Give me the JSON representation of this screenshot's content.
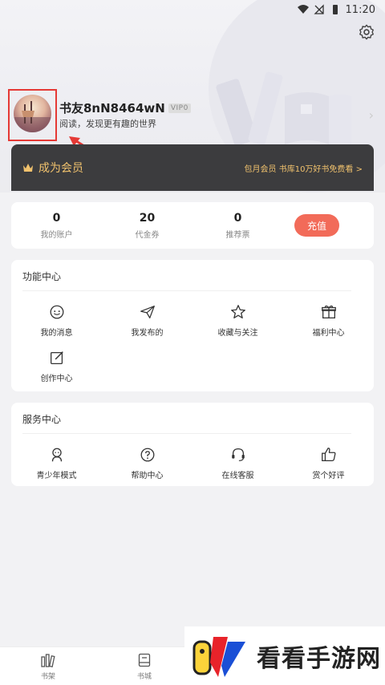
{
  "status_bar": {
    "time": "11:20"
  },
  "profile": {
    "username": "书友8nN8464wN",
    "vip_level": "VIP0",
    "slogan": "阅读，发现更有趣的世界"
  },
  "vip_banner": {
    "title": "成为会员",
    "promo": "包月会员 书库10万好书免费看 >"
  },
  "account": {
    "items": [
      {
        "value": "0",
        "label": "我的账户"
      },
      {
        "value": "20",
        "label": "代金券"
      },
      {
        "value": "0",
        "label": "推荐票"
      }
    ],
    "recharge_label": "充值"
  },
  "function_center": {
    "title": "功能中心",
    "items": [
      {
        "label": "我的消息",
        "icon": "message-icon"
      },
      {
        "label": "我发布的",
        "icon": "send-icon"
      },
      {
        "label": "收藏与关注",
        "icon": "star-icon"
      },
      {
        "label": "福利中心",
        "icon": "gift-icon"
      },
      {
        "label": "创作中心",
        "icon": "edit-icon"
      }
    ]
  },
  "service_center": {
    "title": "服务中心",
    "items": [
      {
        "label": "青少年模式",
        "icon": "teen-icon"
      },
      {
        "label": "帮助中心",
        "icon": "help-icon"
      },
      {
        "label": "在线客服",
        "icon": "headset-icon"
      },
      {
        "label": "赏个好评",
        "icon": "thumbs-up-icon"
      }
    ]
  },
  "bottom_nav": {
    "items": [
      {
        "label": "书架",
        "icon": "bookshelf-icon"
      },
      {
        "label": "书城",
        "icon": "bookstore-icon"
      }
    ]
  },
  "watermark": {
    "text": "看看手游网"
  },
  "colors": {
    "accent": "#f26b59",
    "vip_gold": "#f1c26d",
    "vip_bg": "#3c3c3e",
    "highlight_box": "#e53935"
  }
}
